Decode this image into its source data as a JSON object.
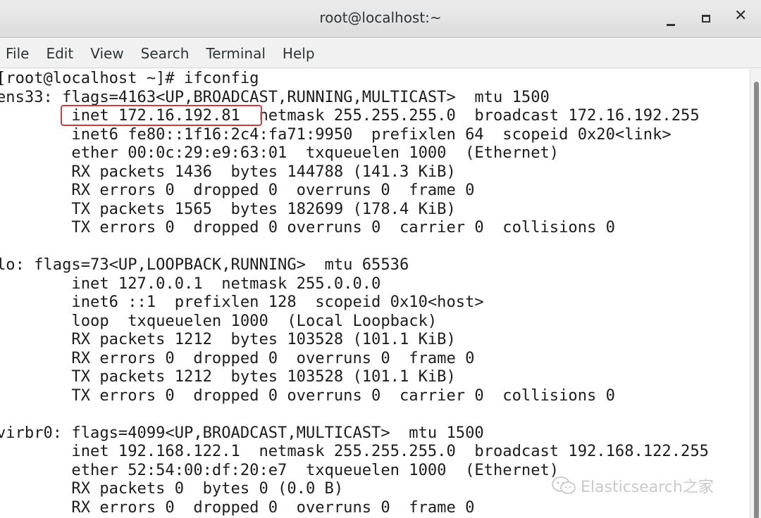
{
  "window": {
    "title": "root@localhost:~"
  },
  "menu": [
    "File",
    "Edit",
    "View",
    "Search",
    "Terminal",
    "Help"
  ],
  "terminal": {
    "lines": [
      "[root@localhost ~]# ifconfig",
      "ens33: flags=4163<UP,BROADCAST,RUNNING,MULTICAST>  mtu 1500",
      "        inet 172.16.192.81  netmask 255.255.255.0  broadcast 172.16.192.255",
      "        inet6 fe80::1f16:2c4:fa71:9950  prefixlen 64  scopeid 0x20<link>",
      "        ether 00:0c:29:e9:63:01  txqueuelen 1000  (Ethernet)",
      "        RX packets 1436  bytes 144788 (141.3 KiB)",
      "        RX errors 0  dropped 0  overruns 0  frame 0",
      "        TX packets 1565  bytes 182699 (178.4 KiB)",
      "        TX errors 0  dropped 0 overruns 0  carrier 0  collisions 0",
      "",
      "lo: flags=73<UP,LOOPBACK,RUNNING>  mtu 65536",
      "        inet 127.0.0.1  netmask 255.0.0.0",
      "        inet6 ::1  prefixlen 128  scopeid 0x10<host>",
      "        loop  txqueuelen 1000  (Local Loopback)",
      "        RX packets 1212  bytes 103528 (101.1 KiB)",
      "        RX errors 0  dropped 0  overruns 0  frame 0",
      "        TX packets 1212  bytes 103528 (101.1 KiB)",
      "        TX errors 0  dropped 0 overruns 0  carrier 0  collisions 0",
      "",
      "virbr0: flags=4099<UP,BROADCAST,MULTICAST>  mtu 1500",
      "        inet 192.168.122.1  netmask 255.255.255.0  broadcast 192.168.122.255",
      "        ether 52:54:00:df:20:e7  txqueuelen 1000  (Ethernet)",
      "        RX packets 0  bytes 0 (0.0 B)",
      "        RX errors 0  dropped 0  overruns 0  frame 0"
    ]
  },
  "watermark": {
    "text": "Elasticsearch之家",
    "icon": "wechat-icon"
  },
  "colors": {
    "highlight": "#d9383a",
    "terminal_bg": "#ffffff",
    "terminal_fg": "#1c1c1c"
  }
}
